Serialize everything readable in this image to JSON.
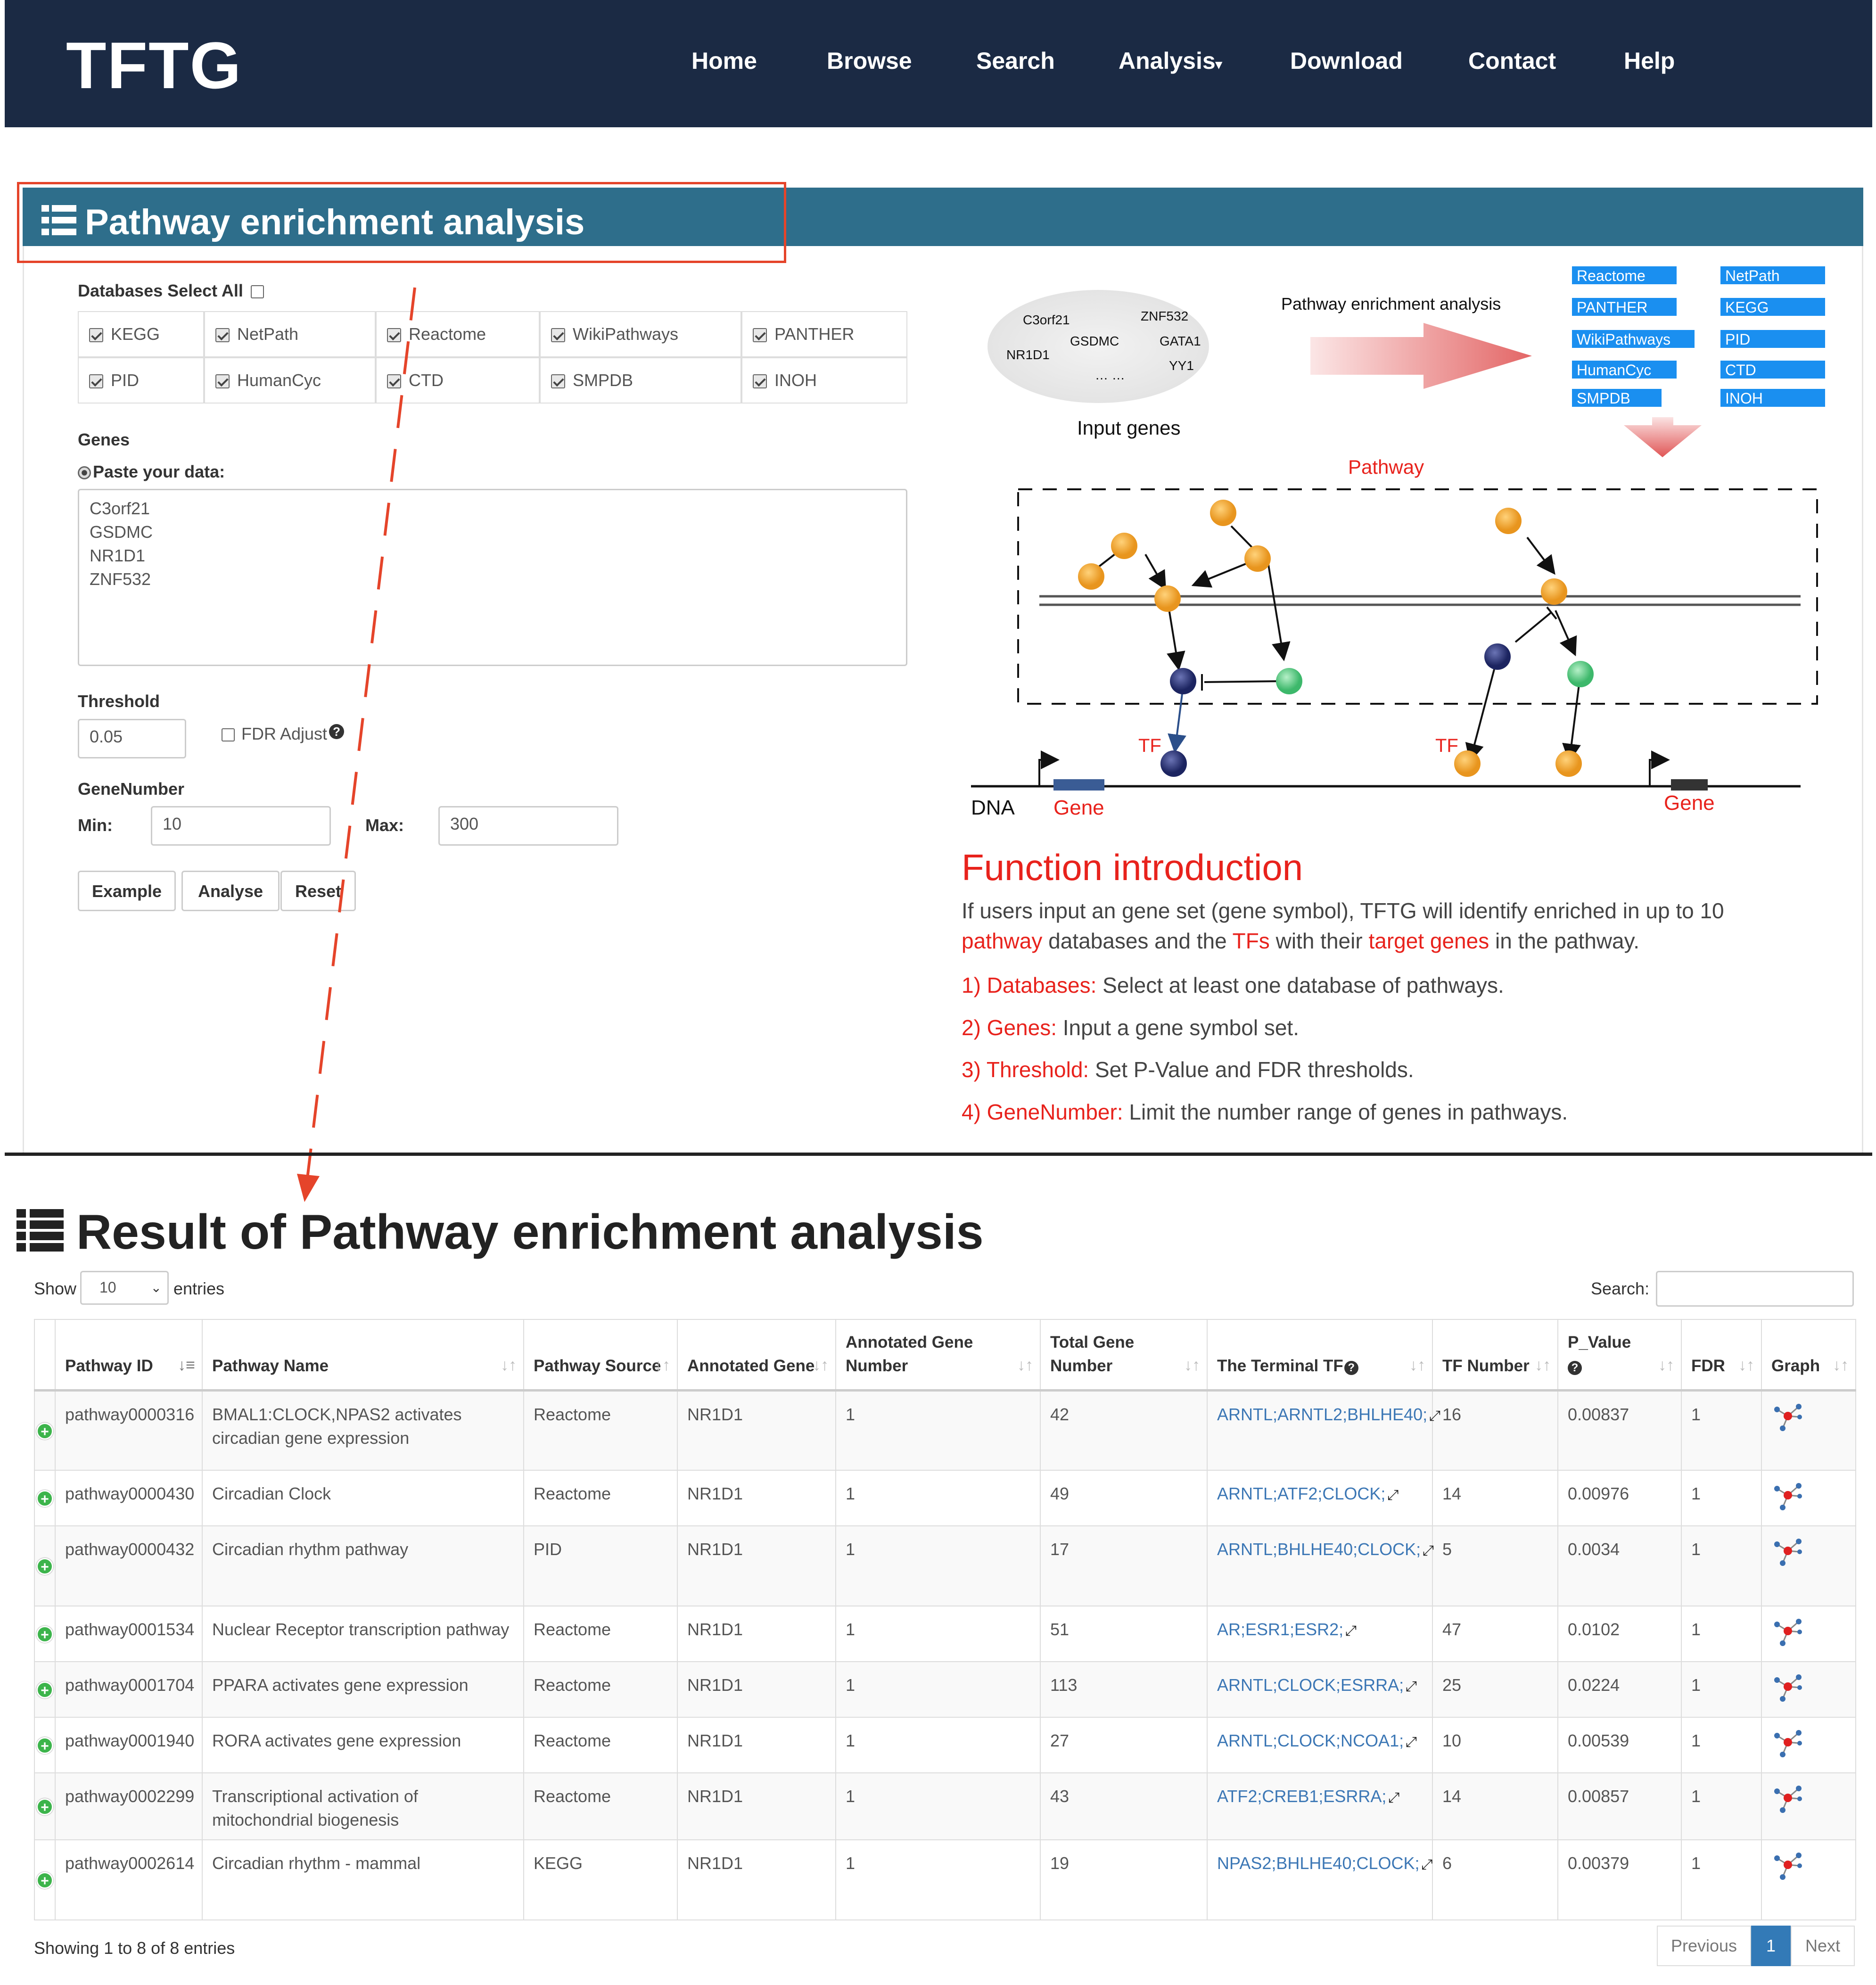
{
  "nav": {
    "brand": "TFTG",
    "items": [
      "Home",
      "Browse",
      "Search",
      "Analysis",
      "Download",
      "Contact",
      "Help"
    ]
  },
  "panel": {
    "title": "Pathway enrichment analysis"
  },
  "form": {
    "databases_label": "Databases Select All",
    "databases": [
      [
        "KEGG",
        "NetPath",
        "Reactome",
        "WikiPathways",
        "PANTHER"
      ],
      [
        "PID",
        "HumanCyc",
        "CTD",
        "SMPDB",
        "INOH"
      ]
    ],
    "genes_label": "Genes",
    "paste_label": "Paste your data:",
    "genes_lines": [
      "C3orf21",
      "GSDMC",
      "NR1D1",
      "ZNF532"
    ],
    "threshold_label": "Threshold",
    "threshold_value": "0.05",
    "fdr_label": "FDR Adjust",
    "genenumber_label": "GeneNumber",
    "min_label": "Min:",
    "min_value": "10",
    "max_label": "Max:",
    "max_value": "300",
    "buttons": [
      "Example",
      "Analyse",
      "Reset"
    ]
  },
  "diagram": {
    "genes": [
      "C3orf21",
      "ZNF532",
      "GSDMC",
      "GATA1",
      "NR1D1",
      "YY1",
      "… …"
    ],
    "input_genes": "Input genes",
    "arrow_label": "Pathway enrichment analysis",
    "dbs": [
      "Reactome",
      "NetPath",
      "PANTHER",
      "KEGG",
      "WikiPathways",
      "PID",
      "HumanCyc",
      "CTD",
      "SMPDB",
      "INOH"
    ],
    "pathway": "Pathway",
    "tf": "TF",
    "dna": "DNA",
    "gene": "Gene"
  },
  "intro": {
    "title": "Function introduction",
    "p1": [
      "If users input an gene set (gene symbol), TFTG will identify enriched in up to 10 ",
      "pathway",
      " databases and the ",
      "TFs",
      " with their ",
      "target genes",
      " in the pathway."
    ],
    "items": [
      [
        "1) Databases:",
        " Select at least one database of pathways."
      ],
      [
        "2) Genes:",
        " Input a gene symbol set."
      ],
      [
        "3) Threshold:",
        " Set P-Value and FDR thresholds."
      ],
      [
        "4) GeneNumber:",
        " Limit the number range of genes in pathways."
      ]
    ]
  },
  "result": {
    "title": "Result of Pathway enrichment analysis",
    "show": "Show",
    "entries": "entries",
    "length": "10",
    "search": "Search:",
    "columns": [
      "Pathway ID",
      "Pathway Name",
      "Pathway Source",
      "Annotated Gene",
      "Annotated Gene Number",
      "Total Gene Number",
      "The Terminal TF",
      "TF Number",
      "P_Value",
      "FDR",
      "Graph"
    ],
    "rows": [
      [
        "pathway0000316",
        "BMAL1:CLOCK,NPAS2 activates circadian gene expression",
        "Reactome",
        "NR1D1",
        "1",
        "42",
        "ARNTL;ARNTL2;BHLHE40;",
        "16",
        "0.00837",
        "1"
      ],
      [
        "pathway0000430",
        "Circadian Clock",
        "Reactome",
        "NR1D1",
        "1",
        "49",
        "ARNTL;ATF2;CLOCK;",
        "14",
        "0.00976",
        "1"
      ],
      [
        "pathway0000432",
        "Circadian rhythm pathway",
        "PID",
        "NR1D1",
        "1",
        "17",
        "ARNTL;BHLHE40;CLOCK;",
        "5",
        "0.0034",
        "1"
      ],
      [
        "pathway0001534",
        "Nuclear Receptor transcription pathway",
        "Reactome",
        "NR1D1",
        "1",
        "51",
        "AR;ESR1;ESR2;",
        "47",
        "0.0102",
        "1"
      ],
      [
        "pathway0001704",
        "PPARA activates gene expression",
        "Reactome",
        "NR1D1",
        "1",
        "113",
        "ARNTL;CLOCK;ESRRA;",
        "25",
        "0.0224",
        "1"
      ],
      [
        "pathway0001940",
        "RORA activates gene expression",
        "Reactome",
        "NR1D1",
        "1",
        "27",
        "ARNTL;CLOCK;NCOA1;",
        "10",
        "0.00539",
        "1"
      ],
      [
        "pathway0002299",
        "Transcriptional activation of mitochondrial biogenesis",
        "Reactome",
        "NR1D1",
        "1",
        "43",
        "ATF2;CREB1;ESRRA;",
        "14",
        "0.00857",
        "1"
      ],
      [
        "pathway0002614",
        "Circadian rhythm - mammal",
        "KEGG",
        "NR1D1",
        "1",
        "19",
        "NPAS2;BHLHE40;CLOCK;",
        "6",
        "0.00379",
        "1"
      ]
    ],
    "info": "Showing 1 to 8 of 8 entries",
    "pager": [
      "Previous",
      "1",
      "Next"
    ]
  }
}
